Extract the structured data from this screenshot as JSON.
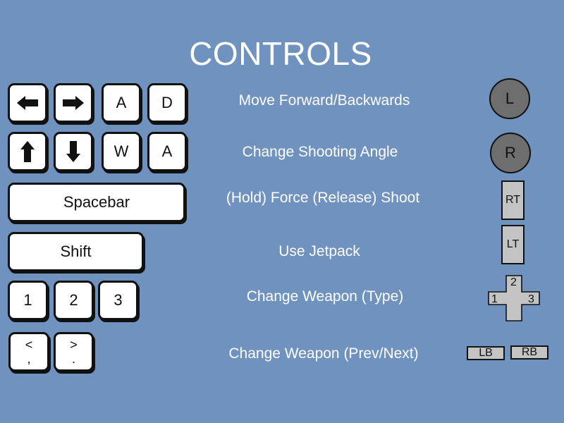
{
  "title": "CONTROLS",
  "keyboard": {
    "row1": [
      {
        "icon": "arrow-left-icon"
      },
      {
        "icon": "arrow-right-icon"
      },
      {
        "label": "A"
      },
      {
        "label": "D"
      }
    ],
    "row2": [
      {
        "icon": "arrow-up-icon"
      },
      {
        "icon": "arrow-down-icon"
      },
      {
        "label": "W"
      },
      {
        "label": "A"
      }
    ],
    "row3": [
      {
        "label": "Spacebar"
      }
    ],
    "row4": [
      {
        "label": "Shift"
      }
    ],
    "row5": [
      {
        "label": "1"
      },
      {
        "label": "2"
      },
      {
        "label": "3"
      }
    ],
    "row6": [
      {
        "top": "<",
        "bottom": ","
      },
      {
        "top": ">",
        "bottom": "."
      }
    ]
  },
  "actions": [
    "Move Forward/Backwards",
    "Change Shooting Angle",
    "(Hold) Force (Release) Shoot",
    "Use Jetpack",
    "Change Weapon (Type)",
    "Change Weapon (Prev/Next)"
  ],
  "gamepad": {
    "left_stick": "L",
    "right_stick": "R",
    "right_trigger": "RT",
    "left_trigger": "LT",
    "dpad": {
      "up": "2",
      "left": "1",
      "right": "3"
    },
    "left_bumper": "LB",
    "right_bumper": "RB"
  },
  "colors": {
    "background": "#7092be",
    "key_fill": "#ffffff",
    "key_border": "#111111",
    "stick_fill": "#6e6e6e",
    "button_fill": "#c3c3c3",
    "text": "#ffffff"
  }
}
